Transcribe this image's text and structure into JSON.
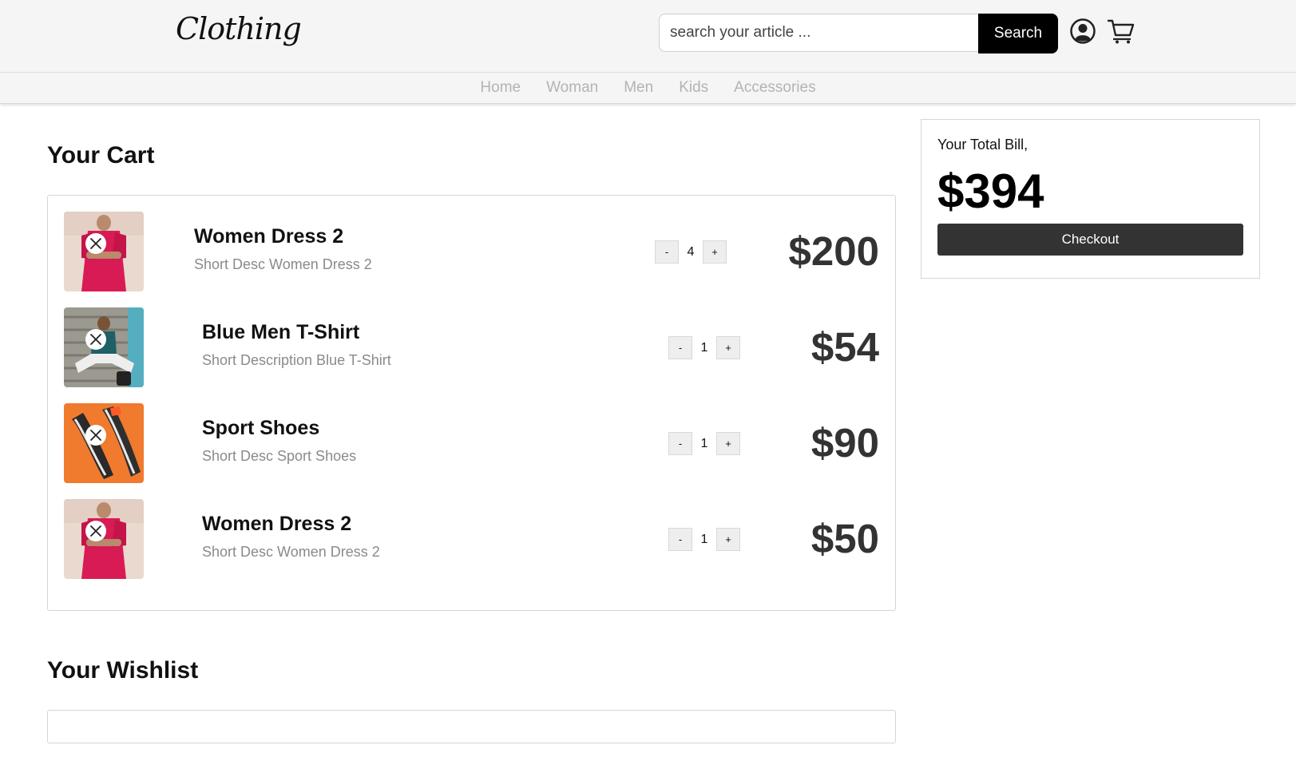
{
  "header": {
    "logo_text": "Clothing",
    "search": {
      "placeholder": "search your article ...",
      "value": ""
    },
    "search_button": "Search",
    "icons": {
      "user": "user-icon",
      "cart": "cart-icon"
    }
  },
  "nav": {
    "items": [
      {
        "label": "Home"
      },
      {
        "label": "Woman"
      },
      {
        "label": "Men"
      },
      {
        "label": "Kids"
      },
      {
        "label": "Accessories"
      }
    ]
  },
  "cart": {
    "title": "Your Cart",
    "items": [
      {
        "name": "Women Dress 2",
        "description": "Short Desc Women Dress 2",
        "quantity": "4",
        "price": "$200",
        "image": "pink-dress-photo"
      },
      {
        "name": "Blue Men T-Shirt",
        "description": "Short Description Blue T-Shirt",
        "quantity": "1",
        "price": "$54",
        "image": "man-tshirt-photo"
      },
      {
        "name": "Sport Shoes",
        "description": "Short Desc Sport Shoes",
        "quantity": "1",
        "price": "$90",
        "image": "sport-shoes-photo"
      },
      {
        "name": "Women Dress 2",
        "description": "Short Desc Women Dress 2",
        "quantity": "1",
        "price": "$50",
        "image": "pink-dress-photo"
      }
    ],
    "qty_minus": "-",
    "qty_plus": "+"
  },
  "wishlist": {
    "title": "Your Wishlist"
  },
  "bill": {
    "label": "Your Total Bill,",
    "total": "$394",
    "checkout": "Checkout"
  },
  "colors": {
    "header_bg": "#f5f5f5",
    "search_button_bg": "#000000",
    "checkout_bg": "#333333",
    "nav_text": "#b3b3b3",
    "desc_text": "#8a8a8a",
    "dress_pink": "#d81b55",
    "shoe_orange": "#f07a2e"
  }
}
